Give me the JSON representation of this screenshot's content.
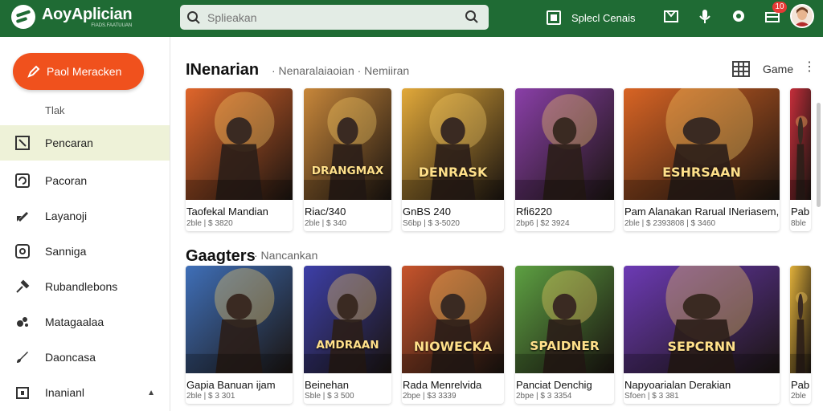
{
  "app": {
    "title": "AoyAplician",
    "subtitle": "FIADS.FAATUUAN"
  },
  "search": {
    "placeholder": "Splieakan"
  },
  "topbar": {
    "action_label": "Splecl Cenais",
    "notification_count": "10"
  },
  "sidebar": {
    "new_button": "Paol Meracken",
    "subheading": "Tlak",
    "items": [
      {
        "label": "Pencaran",
        "icon": "flag-icon",
        "active": true
      },
      {
        "label": "Pacoran",
        "icon": "refresh-icon"
      },
      {
        "label": "Layanoji",
        "icon": "edit-icon"
      },
      {
        "label": "Sanniga",
        "icon": "settings-icon"
      },
      {
        "label": "Rubandlebons",
        "icon": "wrench-icon"
      },
      {
        "label": "Matagaalaa",
        "icon": "palette-icon"
      },
      {
        "label": "Daoncasa",
        "icon": "brush-icon"
      },
      {
        "label": "Inanianl",
        "icon": "archive-icon"
      }
    ]
  },
  "sections": [
    {
      "title": "INenarian",
      "subtitle": "· Nenaralaiaoian · Nemiiran",
      "view_label": "Game",
      "cards": [
        {
          "name": "Taofekal Mandian",
          "meta": "2ble | $ 3820",
          "ribbon": "",
          "art_text": "",
          "accent": "#e0662b"
        },
        {
          "name": "Riac/340",
          "meta": "2ble | $ 340",
          "ribbon": "",
          "art_text": "DRANGMAX",
          "accent": "#c8873a"
        },
        {
          "name": "GnBS 240",
          "meta": "S6bp | $ 3-5020",
          "ribbon": "",
          "art_text": "DENRASK",
          "accent": "#e2a93a"
        },
        {
          "name": "Rfi6220",
          "meta": "2bp6 | $2 3924",
          "ribbon": "",
          "art_text": "",
          "accent": "#8a3fa8"
        },
        {
          "name": "Pam Alanakan Rarual INeriasem,",
          "meta": "2ble | $ 2393808 | $ 3460",
          "ribbon": "",
          "art_text": "ESHRSAAN",
          "accent": "#d86424"
        },
        {
          "name": "Pab",
          "meta": "8ble",
          "ribbon": "",
          "art_text": "",
          "accent": "#c62e3b"
        }
      ]
    },
    {
      "title": "Gaagters",
      "subtitle": "· Nancankan",
      "cards": [
        {
          "name": "Gapia Banuan ijam",
          "meta": "2ble | $ 3 301",
          "ribbon": "",
          "art_text": "",
          "accent": "#3f6fb8"
        },
        {
          "name": "Beinehan",
          "meta": "Sble | $ 3 500",
          "ribbon": "",
          "art_text": "AMDRAAN",
          "accent": "#3d3fa8"
        },
        {
          "name": "Rada Menrelvida",
          "meta": "2bpe | $3 3339",
          "ribbon": "",
          "art_text": "NIOWECKA",
          "accent": "#c7542c"
        },
        {
          "name": "Panciat Denchig",
          "meta": "2bpe | $ 3 3354",
          "ribbon": "",
          "art_text": "SPAIDNER",
          "accent": "#5da042"
        },
        {
          "name": "Napyoarialan Derakian",
          "meta": "Sfoen | $ 3 381",
          "ribbon": "",
          "art_text": "SEPCRNN",
          "accent": "#6c3ab4"
        },
        {
          "name": "Pab",
          "meta": "2ble",
          "ribbon": "",
          "art_text": "",
          "accent": "#e0b03a"
        }
      ]
    }
  ]
}
